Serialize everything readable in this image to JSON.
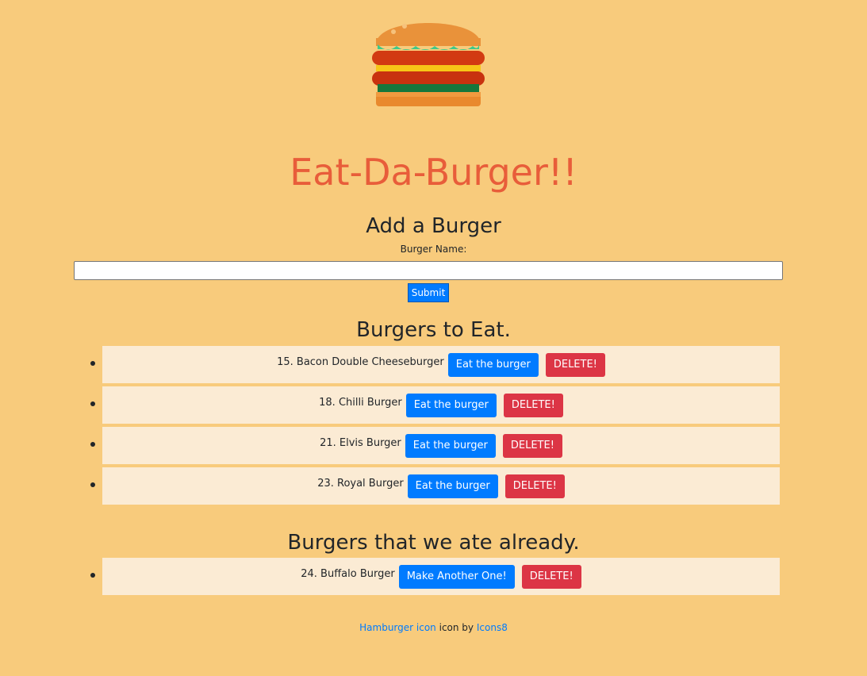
{
  "app": {
    "title": "Eat-Da-Burger!!",
    "logo_icon": "hamburger-icon"
  },
  "add_form": {
    "heading": "Add a Burger",
    "label": "Burger Name:",
    "input_value": "",
    "input_placeholder": "",
    "submit_label": "Submit"
  },
  "to_eat": {
    "heading": "Burgers to Eat.",
    "items": [
      {
        "name": "15. Bacon Double Cheeseburger",
        "action_label": "Eat the burger",
        "delete_label": "DELETE!"
      },
      {
        "name": "18. Chilli Burger",
        "action_label": "Eat the burger",
        "delete_label": "DELETE!"
      },
      {
        "name": "21. Elvis Burger",
        "action_label": "Eat the burger",
        "delete_label": "DELETE!"
      },
      {
        "name": "23. Royal Burger",
        "action_label": "Eat the burger",
        "delete_label": "DELETE!"
      }
    ]
  },
  "eaten": {
    "heading": "Burgers that we ate already.",
    "items": [
      {
        "name": "24. Buffalo Burger",
        "action_label": "Make Another One!",
        "delete_label": "DELETE!"
      }
    ]
  },
  "footer": {
    "link1": "Hamburger icon",
    "middle": "icon by",
    "link2": "Icons8"
  },
  "colors": {
    "background": "#f8cb7c",
    "title": "#e85d3a",
    "primary": "#007bff",
    "danger": "#dc3545",
    "list_item_bg": "#fbebd4"
  }
}
